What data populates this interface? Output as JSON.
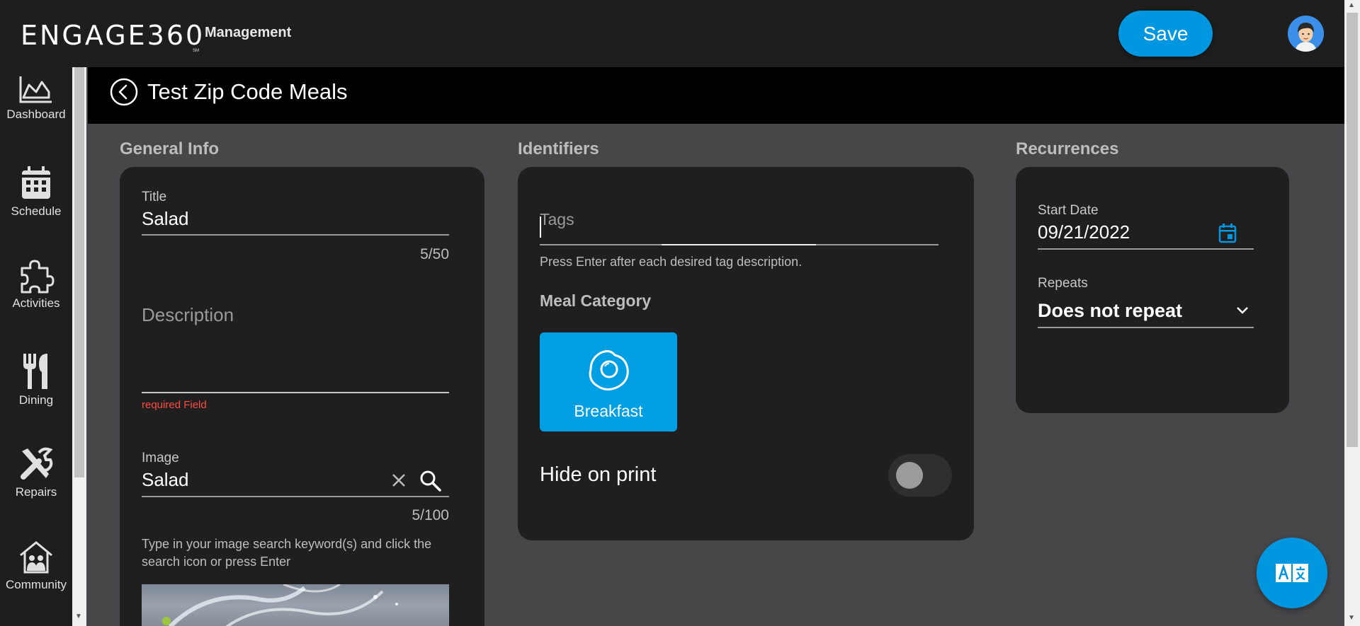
{
  "app": {
    "logo_text": "ENGAGE360",
    "logo_mark": "SM",
    "section": "Management",
    "save_label": "Save"
  },
  "sidebar": {
    "items": [
      {
        "label": "Dashboard",
        "icon": "chart-icon"
      },
      {
        "label": "Schedule",
        "icon": "calendar-icon"
      },
      {
        "label": "Activities",
        "icon": "puzzle-icon"
      },
      {
        "label": "Dining",
        "icon": "utensils-icon"
      },
      {
        "label": "Repairs",
        "icon": "tools-icon"
      },
      {
        "label": "Community",
        "icon": "house-people-icon"
      }
    ]
  },
  "page": {
    "title": "Test Zip Code Meals"
  },
  "general_info": {
    "heading": "General Info",
    "title_label": "Title",
    "title_value": "Salad",
    "title_counter": "5/50",
    "description_placeholder": "Description",
    "description_error": "required Field",
    "image_label": "Image",
    "image_value": "Salad",
    "image_counter": "5/100",
    "image_hint": "Type in your image search keyword(s) and click the search icon or press Enter"
  },
  "identifiers": {
    "heading": "Identifiers",
    "tags_placeholder": "Tags",
    "tags_hint": "Press Enter after each desired tag description.",
    "meal_category_heading": "Meal Category",
    "meal_category_selected": "Breakfast",
    "hide_on_print_label": "Hide on print",
    "hide_on_print_on": false
  },
  "recurrences": {
    "heading": "Recurrences",
    "start_date_label": "Start Date",
    "start_date_value": "09/21/2022",
    "repeats_label": "Repeats",
    "repeats_value": "Does not repeat"
  },
  "colors": {
    "accent": "#0096e0",
    "error": "#ff4a3d",
    "panel": "#1f1f20",
    "background": "#47474a"
  }
}
